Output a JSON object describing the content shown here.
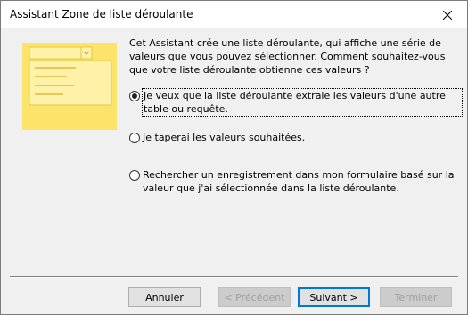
{
  "window": {
    "title": "Assistant Zone de liste déroulante",
    "close_icon": "close-icon"
  },
  "description": "Cet Assistant crée une liste déroulante, qui affiche une série de valeurs que vous pouvez sélectionner. Comment souhaitez-vous que votre liste déroulante obtienne ces valeurs ?",
  "options": [
    {
      "label": "Je veux que la liste déroulante extraie les valeurs d'une autre table ou requête.",
      "selected": true
    },
    {
      "label": "Je taperai les valeurs souhaitées.",
      "selected": false
    },
    {
      "label": "Rechercher un enregistrement dans mon formulaire basé sur la valeur que j'ai sélectionnée dans la liste déroulante.",
      "selected": false
    }
  ],
  "buttons": {
    "cancel": "Annuler",
    "previous": "< Précédent",
    "next": "Suivant >",
    "finish": "Terminer"
  },
  "colors": {
    "illustration_yellow": "#fce46a",
    "illustration_light": "#fdf2a8",
    "default_button_border": "#0078d7"
  }
}
